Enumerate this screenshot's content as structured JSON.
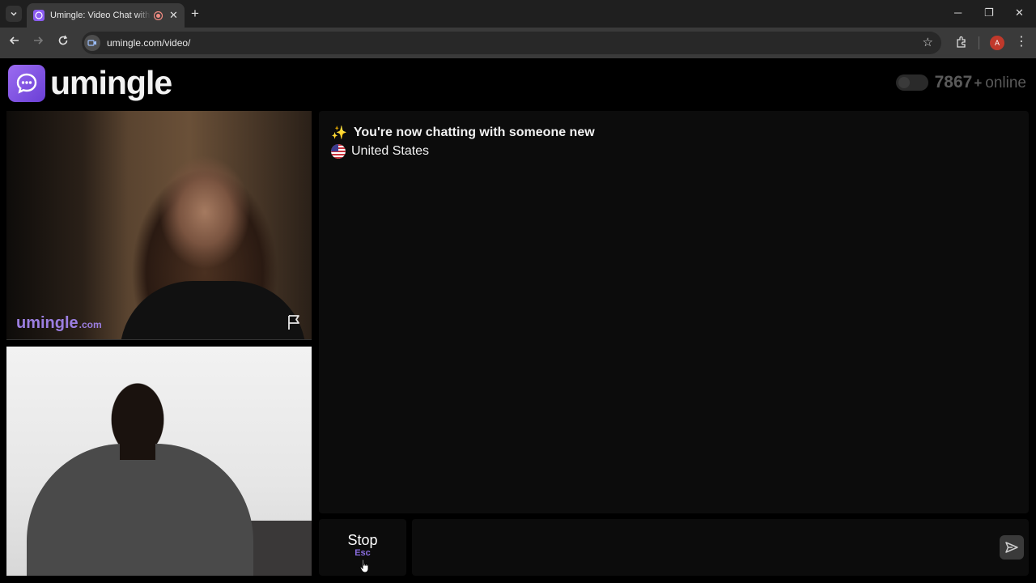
{
  "browser": {
    "tab_title": "Umingle: Video Chat with Strangers",
    "url": "umingle.com/video/",
    "profile_initial": "A",
    "window_minimize": "─",
    "window_restore": "❐",
    "window_close": "✕",
    "new_tab": "+",
    "tab_close": "✕"
  },
  "header": {
    "logo_text": "umingle",
    "online_count": "7867",
    "online_plus": "+",
    "online_label": "online"
  },
  "video": {
    "watermark_main": "umingle",
    "watermark_tld": ".com"
  },
  "chat": {
    "system_message": "You're now chatting with someone new",
    "country": "United States"
  },
  "controls": {
    "stop_label": "Stop",
    "stop_shortcut": "Esc",
    "message_placeholder": ""
  },
  "colors": {
    "accent": "#8a6de0",
    "background": "#000000",
    "panel": "#0c0c0c"
  },
  "icons": {
    "chat_logo": "chat-bubble-icon",
    "report": "flag-icon",
    "send": "send-icon",
    "sparkle": "sparkles-icon",
    "country_flag": "us-flag-icon"
  }
}
